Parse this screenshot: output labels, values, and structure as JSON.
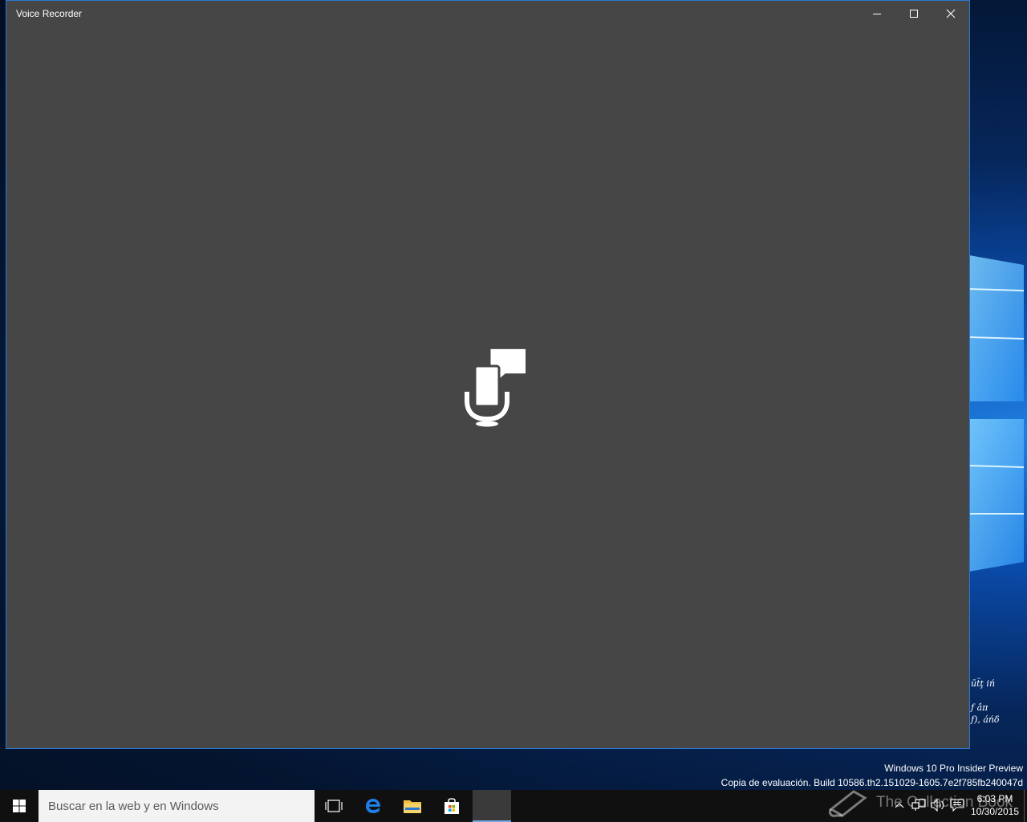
{
  "window": {
    "title": "Voice Recorder",
    "minimize_icon": "minimize-icon",
    "maximize_icon": "maximize-icon",
    "close_icon": "close-icon",
    "center_icon": "microphone-speech-icon",
    "background_color": "#464646",
    "border_color": "#2b79d3"
  },
  "desktop": {
    "garbled_text": {
      "line1": "ūẗţ iń",
      "line2": "ƒ âπ",
      "line3": "ƒ), áńδ"
    },
    "watermark": {
      "line1": "Windows 10 Pro Insider Preview",
      "line2": "Copia de evaluación. Build 10586.th2.151029-1605.7e2f785fb240047d"
    }
  },
  "taskbar": {
    "start_icon": "windows-start-icon",
    "search_placeholder": "Buscar en la web y en Windows",
    "pinned": [
      {
        "name": "task-view-icon"
      },
      {
        "name": "edge-icon"
      },
      {
        "name": "file-explorer-icon"
      },
      {
        "name": "store-icon"
      },
      {
        "name": "voice-recorder-taskbar-icon"
      }
    ],
    "tray": {
      "overlay_text": "The Collection Book",
      "time": "6:03 PM",
      "date": "10/30/2015",
      "icons": [
        "chevron-up-icon",
        "network-icon",
        "volume-icon",
        "action-center-icon"
      ]
    }
  }
}
